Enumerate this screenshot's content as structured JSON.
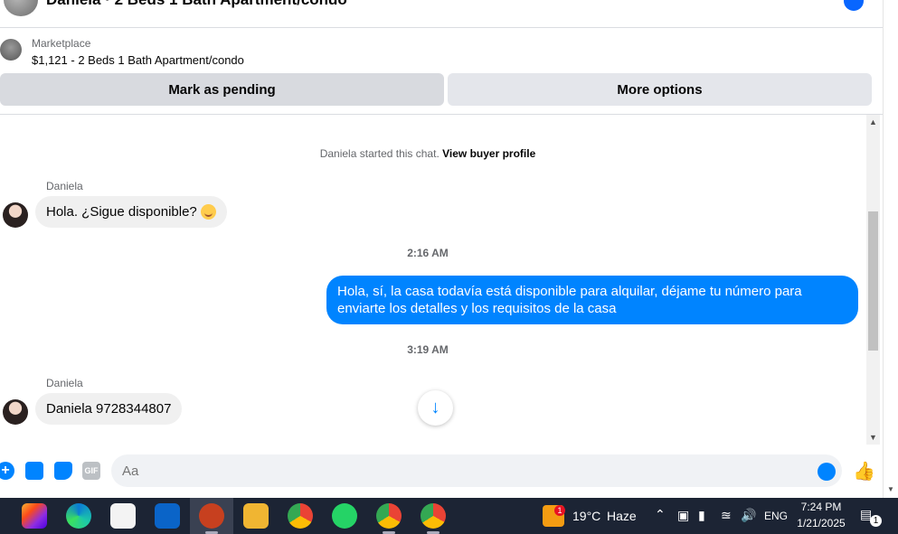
{
  "header": {
    "title": "Daniela · 2 Beds 1 Bath Apartment/condo"
  },
  "listing": {
    "label": "Marketplace",
    "price": "$1,121 - 2 Beds 1 Bath Apartment/condo"
  },
  "actions": {
    "pending": "Mark as pending",
    "more": "More options"
  },
  "chat": {
    "started_prefix": "Daniela started this chat.",
    "started_link": "View buyer profile",
    "messages": [
      {
        "sender": "Daniela",
        "text": "Hola. ¿Sigue disponible?"
      },
      {
        "timestamp": "2:16 AM"
      },
      {
        "text": "Hola, sí, la casa todavía está disponible para alquilar, déjame tu número para enviarte los detalles y los requisitos de la casa"
      },
      {
        "timestamp": "3:19 AM"
      },
      {
        "sender": "Daniela",
        "text": "Daniela 9728344807"
      }
    ]
  },
  "composer": {
    "placeholder": "Aa",
    "gif_label": "GIF"
  },
  "taskbar": {
    "weather_temp": "19°C",
    "weather_desc": "Haze",
    "weather_badge": "1",
    "language": "ENG",
    "time": "7:24 PM",
    "date": "1/21/2025",
    "notification_count": "1"
  },
  "colors": {
    "accent": "#0084ff",
    "bubble_in": "#f0f0f0",
    "taskbar": "#1c2434"
  }
}
